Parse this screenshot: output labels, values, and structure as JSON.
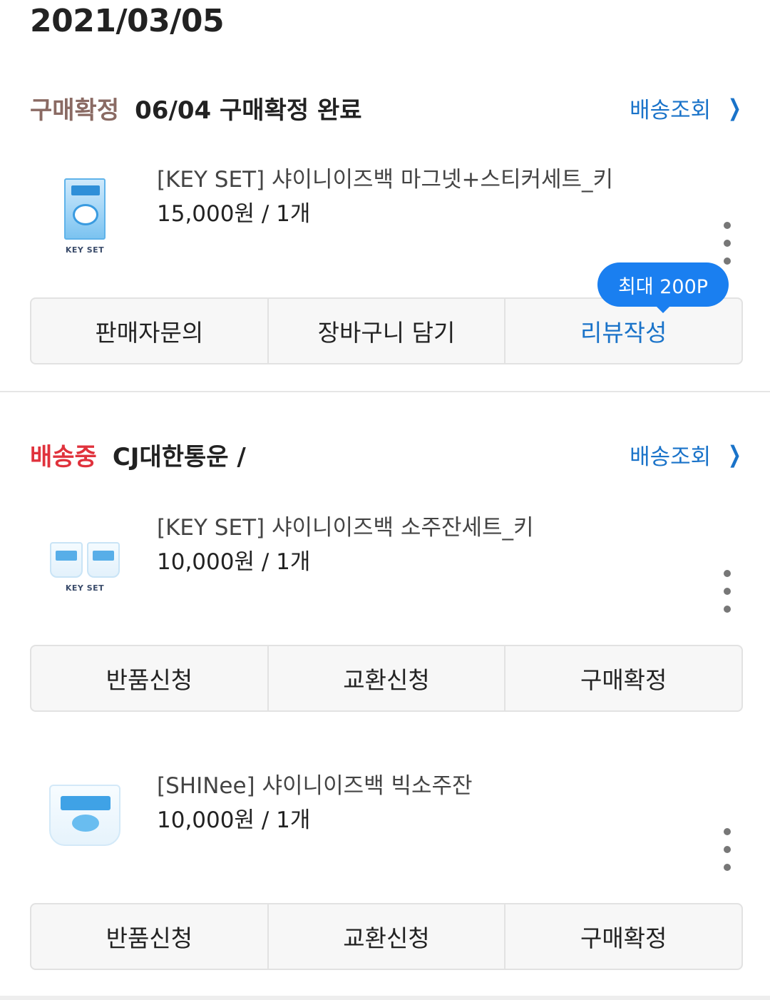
{
  "order": {
    "date": "2021/03/05",
    "groups": [
      {
        "status": "구매확정",
        "status_color": "#8a6a63",
        "detail": "06/04 구매확정 완료",
        "track_label": "배송조회",
        "items": [
          {
            "name": "[KEY SET] 샤이니이즈백 마그넷+스티커세트_키",
            "price": "15,000원 / 1개",
            "thumb_caption": "KEY SET",
            "tooltip": "최대 200P",
            "buttons": [
              "판매자문의",
              "장바구니 담기",
              "리뷰작성"
            ]
          }
        ]
      },
      {
        "status": "배송중",
        "status_color": "#e0323c",
        "detail": "CJ대한통운 /",
        "track_label": "배송조회",
        "items": [
          {
            "name": "[KEY SET] 샤이니이즈백 소주잔세트_키",
            "price": "10,000원 / 1개",
            "thumb_caption": "KEY SET",
            "buttons": [
              "반품신청",
              "교환신청",
              "구매확정"
            ]
          },
          {
            "name": "[SHINee] 샤이니이즈백 빅소주잔",
            "price": "10,000원 / 1개",
            "buttons": [
              "반품신청",
              "교환신청",
              "구매확정"
            ]
          }
        ]
      }
    ]
  },
  "colors": {
    "link": "#1a73c9",
    "tooltip_bg": "#1a7ff0"
  },
  "icons": {
    "track": "chevron-right-icon",
    "more": "more-vertical-icon"
  }
}
